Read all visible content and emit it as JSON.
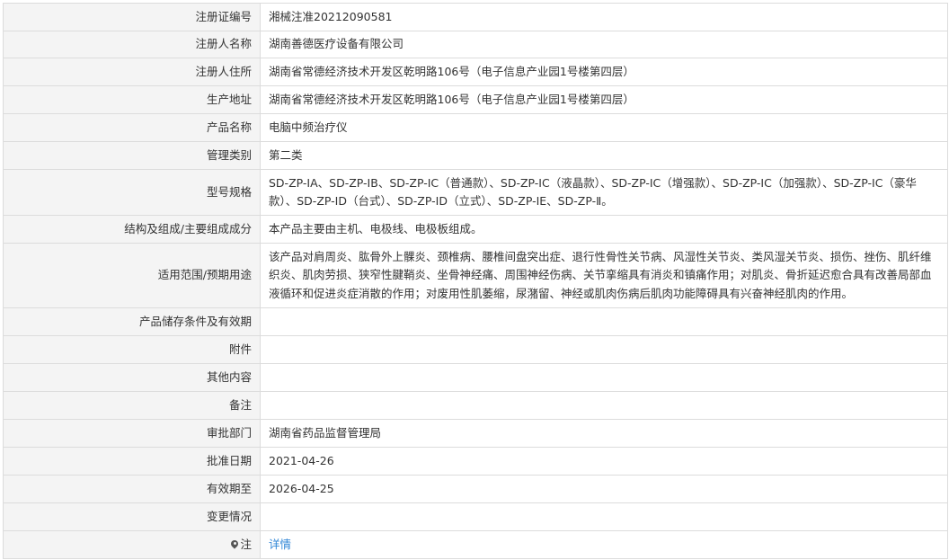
{
  "rows": [
    {
      "label": "注册证编号",
      "value": "湘械注准20212090581"
    },
    {
      "label": "注册人名称",
      "value": "湖南善德医疗设备有限公司"
    },
    {
      "label": "注册人住所",
      "value": "湖南省常德经济技术开发区乾明路106号（电子信息产业园1号楼第四层）"
    },
    {
      "label": "生产地址",
      "value": "湖南省常德经济技术开发区乾明路106号（电子信息产业园1号楼第四层）"
    },
    {
      "label": "产品名称",
      "value": "电脑中频治疗仪"
    },
    {
      "label": "管理类别",
      "value": "第二类"
    },
    {
      "label": "型号规格",
      "value": "SD-ZP-IA、SD-ZP-IB、SD-ZP-IC（普通款）、SD-ZP-IC（液晶款）、SD-ZP-IC（增强款）、SD-ZP-IC（加强款）、SD-ZP-IC（豪华款）、SD-ZP-ID（台式）、SD-ZP-ID（立式）、SD-ZP-IE、SD-ZP-Ⅱ。"
    },
    {
      "label": "结构及组成/主要组成成分",
      "value": "本产品主要由主机、电极线、电极板组成。"
    },
    {
      "label": "适用范围/预期用途",
      "value": "该产品对肩周炎、肱骨外上髁炎、颈椎病、腰椎间盘突出症、退行性骨性关节病、风湿性关节炎、类风湿关节炎、损伤、挫伤、肌纤维织炎、肌肉劳损、狭窄性腱鞘炎、坐骨神经痛、周围神经伤病、关节挛缩具有消炎和镇痛作用；对肌炎、骨折延迟愈合具有改善局部血液循环和促进炎症消散的作用；对废用性肌萎缩，尿潴留、神经或肌肉伤病后肌肉功能障碍具有兴奋神经肌肉的作用。"
    },
    {
      "label": "产品储存条件及有效期",
      "value": ""
    },
    {
      "label": "附件",
      "value": ""
    },
    {
      "label": "其他内容",
      "value": ""
    },
    {
      "label": "备注",
      "value": ""
    },
    {
      "label": "审批部门",
      "value": "湖南省药品监督管理局"
    },
    {
      "label": "批准日期",
      "value": "2021-04-26"
    },
    {
      "label": "有效期至",
      "value": "2026-04-25"
    },
    {
      "label": "变更情况",
      "value": ""
    }
  ],
  "note": {
    "icon": "pin-icon",
    "label": "注",
    "link_text": "详情",
    "link_color": "#2f86d6"
  }
}
